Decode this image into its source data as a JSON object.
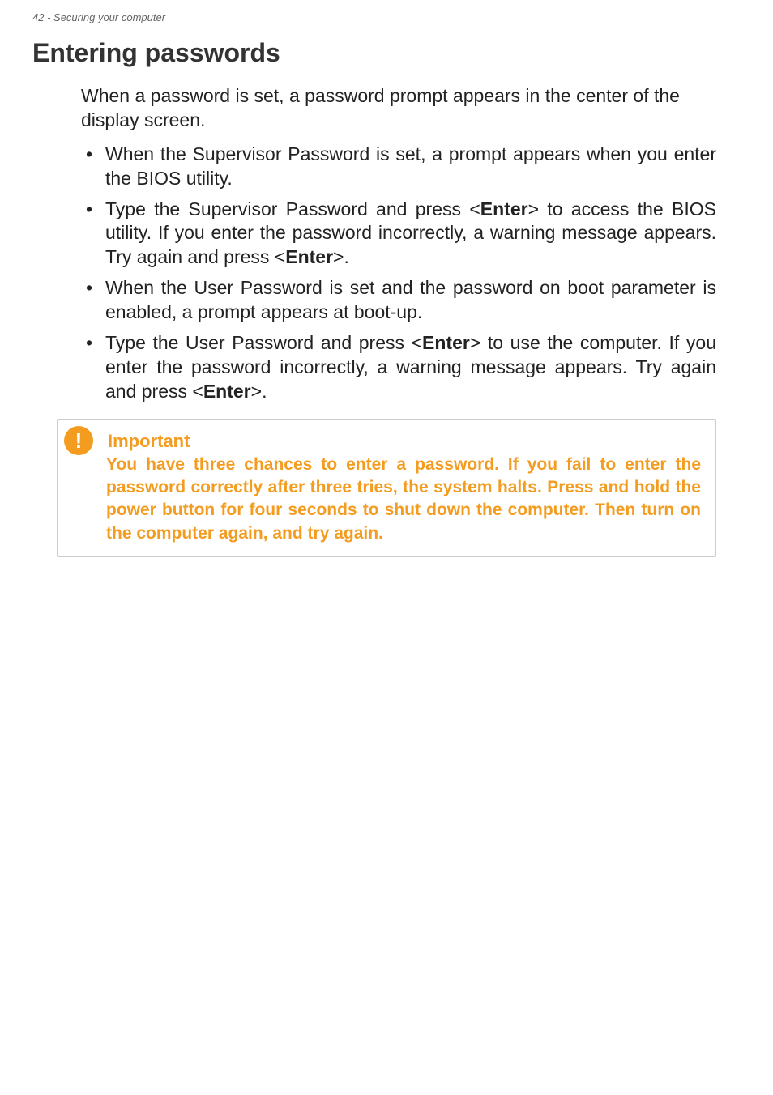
{
  "header": {
    "page_number": "42",
    "section": "Securing your computer"
  },
  "section_title": "Entering passwords",
  "intro": "When a password is set, a password prompt appears in the center of the display screen.",
  "bullets": [
    {
      "pre": "When the Supervisor Password is set, a prompt appears when you enter the BIOS utility."
    },
    {
      "pre": "Type the Supervisor Password and press <",
      "bold1": "Enter",
      "mid": "> to access the BIOS utility. If you enter the password incorrectly, a warning message appears. Try again and press <",
      "bold2": "Enter",
      "post": ">."
    },
    {
      "pre": "When the User Password is set and the password on boot parameter is enabled, a prompt appears at boot-up."
    },
    {
      "pre": "Type the User Password and press <",
      "bold1": "Enter",
      "mid": "> to use the computer. If you enter the password incorrectly, a warning message appears. Try again and press <",
      "bold2": "Enter",
      "post": ">."
    }
  ],
  "important": {
    "title": "Important",
    "body": "You have three chances to enter a password. If you fail to enter the password correctly after three tries, the system halts. Press and hold the power button for four seconds to shut down the computer. Then turn on the computer again, and try again."
  }
}
